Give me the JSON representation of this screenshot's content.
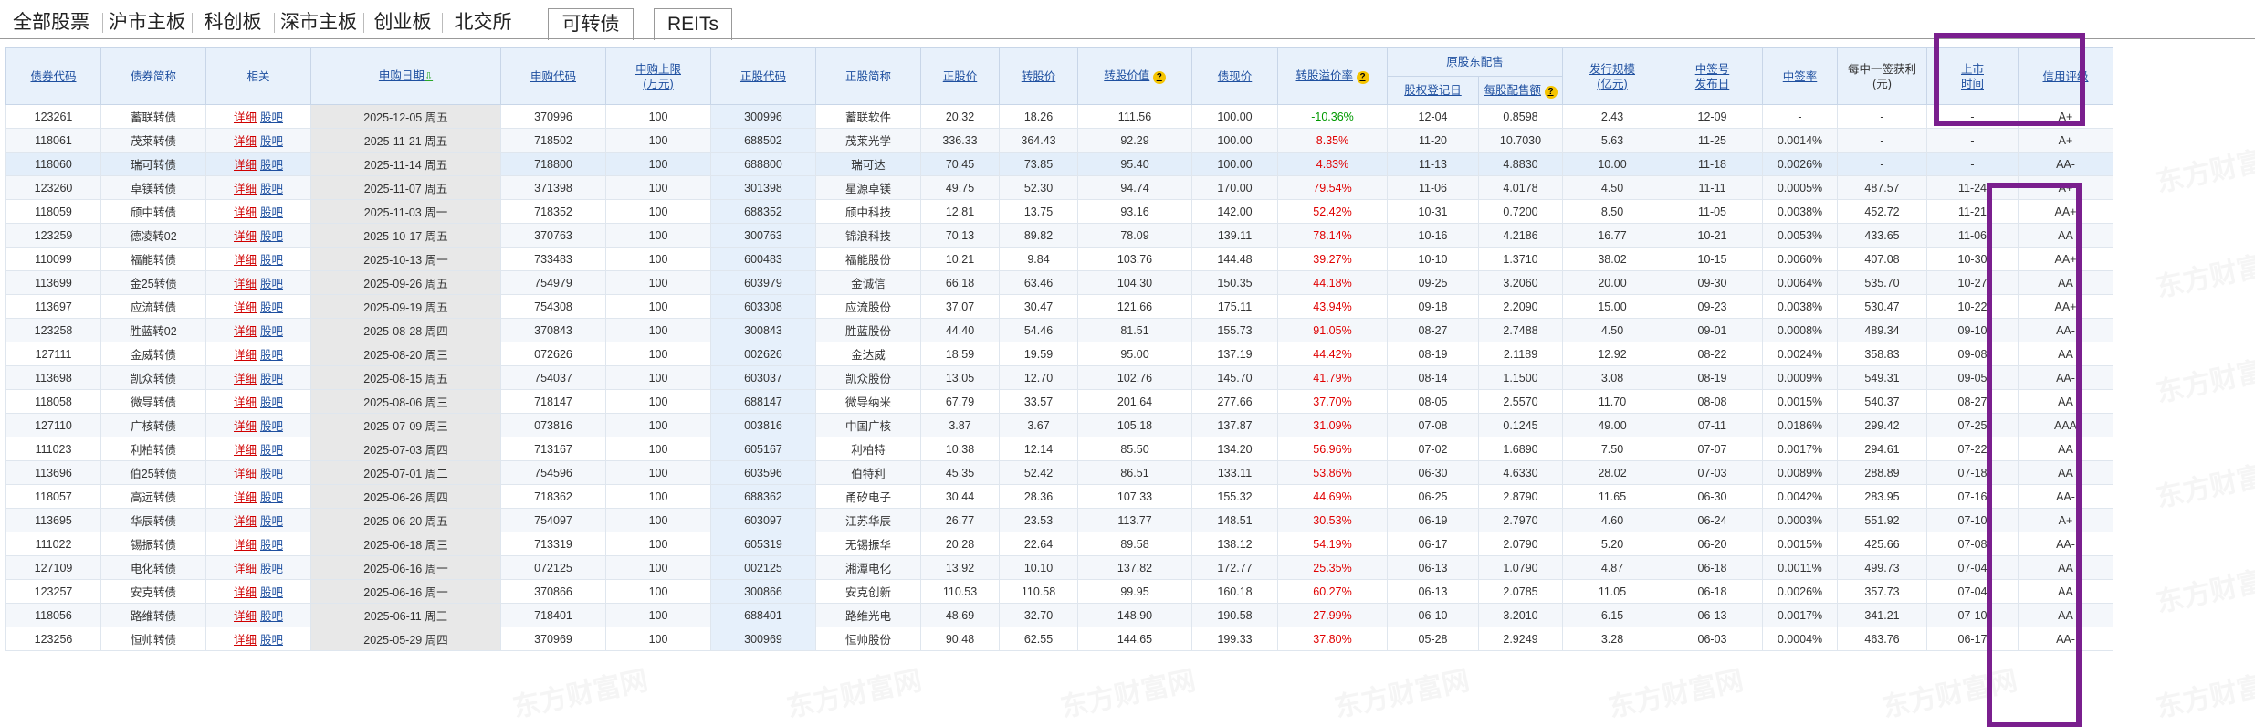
{
  "tabs": [
    {
      "label": "全部股票",
      "active": false
    },
    {
      "label": "沪市主板",
      "active": false
    },
    {
      "label": "科创板",
      "active": false
    },
    {
      "label": "深市主板",
      "active": false
    },
    {
      "label": "创业板",
      "active": false
    },
    {
      "label": "北交所",
      "active": false
    },
    {
      "label": "可转债",
      "active": true
    },
    {
      "label": "REITs",
      "active": false
    }
  ],
  "watermark": "东方财富网",
  "headers": {
    "bond_code": "债券代码",
    "bond_name": "债券简称",
    "related": "相关",
    "sub_date": "申购日期",
    "sub_code": "申购代码",
    "sub_limit_1": "申购上限",
    "sub_limit_2": "(万元)",
    "stock_code": "正股代码",
    "stock_name": "正股简称",
    "stock_price": "正股价",
    "conv_price": "转股价",
    "conv_value": "转股价值",
    "bond_price": "债现价",
    "premium": "转股溢价率",
    "placement": "原股东配售",
    "record_date": "股权登记日",
    "per_share": "每股配售额",
    "issue_size_1": "发行规模",
    "issue_size_2": "(亿元)",
    "lottery_1": "中签号",
    "lottery_2": "发布日",
    "win_rate": "中签率",
    "profit": "每中一签获利(元)",
    "listing_1": "上市",
    "listing_2": "时间",
    "rating": "信用评级"
  },
  "link_labels": {
    "detail": "详细",
    "forum": "股吧"
  },
  "rows": [
    {
      "code": "123261",
      "name": "蓄联转债",
      "date": "2025-12-05 周五",
      "sub_code": "370996",
      "limit": "100",
      "stock_code": "300996",
      "stock_name": "蓄联软件",
      "stock_price": "20.32",
      "conv_price": "18.26",
      "conv_value": "111.56",
      "bond_price": "100.00",
      "premium": "-10.36%",
      "record": "12-04",
      "per_share": "0.8598",
      "issue": "2.43",
      "lottery": "12-09",
      "rate": "-",
      "profit": "-",
      "listing": "-",
      "rating": "A+"
    },
    {
      "code": "118061",
      "name": "茂莱转债",
      "date": "2025-11-21 周五",
      "sub_code": "718502",
      "limit": "100",
      "stock_code": "688502",
      "stock_name": "茂莱光学",
      "stock_price": "336.33",
      "conv_price": "364.43",
      "conv_value": "92.29",
      "bond_price": "100.00",
      "premium": "8.35%",
      "record": "11-20",
      "per_share": "10.7030",
      "issue": "5.63",
      "lottery": "11-25",
      "rate": "0.0014%",
      "profit": "-",
      "listing": "-",
      "rating": "A+"
    },
    {
      "code": "118060",
      "name": "瑞可转债",
      "date": "2025-11-14 周五",
      "sub_code": "718800",
      "limit": "100",
      "stock_code": "688800",
      "stock_name": "瑞可达",
      "stock_price": "70.45",
      "conv_price": "73.85",
      "conv_value": "95.40",
      "bond_price": "100.00",
      "premium": "4.83%",
      "record": "11-13",
      "per_share": "4.8830",
      "issue": "10.00",
      "lottery": "11-18",
      "rate": "0.0026%",
      "profit": "-",
      "listing": "-",
      "rating": "AA-"
    },
    {
      "code": "123260",
      "name": "卓镁转债",
      "date": "2025-11-07 周五",
      "sub_code": "371398",
      "limit": "100",
      "stock_code": "301398",
      "stock_name": "星源卓镁",
      "stock_price": "49.75",
      "conv_price": "52.30",
      "conv_value": "94.74",
      "bond_price": "170.00",
      "premium": "79.54%",
      "record": "11-06",
      "per_share": "4.0178",
      "issue": "4.50",
      "lottery": "11-11",
      "rate": "0.0005%",
      "profit": "487.57",
      "listing": "11-24",
      "rating": "A+"
    },
    {
      "code": "118059",
      "name": "颀中转债",
      "date": "2025-11-03 周一",
      "sub_code": "718352",
      "limit": "100",
      "stock_code": "688352",
      "stock_name": "颀中科技",
      "stock_price": "12.81",
      "conv_price": "13.75",
      "conv_value": "93.16",
      "bond_price": "142.00",
      "premium": "52.42%",
      "record": "10-31",
      "per_share": "0.7200",
      "issue": "8.50",
      "lottery": "11-05",
      "rate": "0.0038%",
      "profit": "452.72",
      "listing": "11-21",
      "rating": "AA+"
    },
    {
      "code": "123259",
      "name": "德凌转02",
      "date": "2025-10-17 周五",
      "sub_code": "370763",
      "limit": "100",
      "stock_code": "300763",
      "stock_name": "锦浪科技",
      "stock_price": "70.13",
      "conv_price": "89.82",
      "conv_value": "78.09",
      "bond_price": "139.11",
      "premium": "78.14%",
      "record": "10-16",
      "per_share": "4.2186",
      "issue": "16.77",
      "lottery": "10-21",
      "rate": "0.0053%",
      "profit": "433.65",
      "listing": "11-06",
      "rating": "AA"
    },
    {
      "code": "110099",
      "name": "福能转债",
      "date": "2025-10-13 周一",
      "sub_code": "733483",
      "limit": "100",
      "stock_code": "600483",
      "stock_name": "福能股份",
      "stock_price": "10.21",
      "conv_price": "9.84",
      "conv_value": "103.76",
      "bond_price": "144.48",
      "premium": "39.27%",
      "record": "10-10",
      "per_share": "1.3710",
      "issue": "38.02",
      "lottery": "10-15",
      "rate": "0.0060%",
      "profit": "407.08",
      "listing": "10-30",
      "rating": "AA+"
    },
    {
      "code": "113699",
      "name": "金25转债",
      "date": "2025-09-26 周五",
      "sub_code": "754979",
      "limit": "100",
      "stock_code": "603979",
      "stock_name": "金诚信",
      "stock_price": "66.18",
      "conv_price": "63.46",
      "conv_value": "104.30",
      "bond_price": "150.35",
      "premium": "44.18%",
      "record": "09-25",
      "per_share": "3.2060",
      "issue": "20.00",
      "lottery": "09-30",
      "rate": "0.0064%",
      "profit": "535.70",
      "listing": "10-27",
      "rating": "AA"
    },
    {
      "code": "113697",
      "name": "应流转债",
      "date": "2025-09-19 周五",
      "sub_code": "754308",
      "limit": "100",
      "stock_code": "603308",
      "stock_name": "应流股份",
      "stock_price": "37.07",
      "conv_price": "30.47",
      "conv_value": "121.66",
      "bond_price": "175.11",
      "premium": "43.94%",
      "record": "09-18",
      "per_share": "2.2090",
      "issue": "15.00",
      "lottery": "09-23",
      "rate": "0.0038%",
      "profit": "530.47",
      "listing": "10-22",
      "rating": "AA+"
    },
    {
      "code": "123258",
      "name": "胜蓝转02",
      "date": "2025-08-28 周四",
      "sub_code": "370843",
      "limit": "100",
      "stock_code": "300843",
      "stock_name": "胜蓝股份",
      "stock_price": "44.40",
      "conv_price": "54.46",
      "conv_value": "81.51",
      "bond_price": "155.73",
      "premium": "91.05%",
      "record": "08-27",
      "per_share": "2.7488",
      "issue": "4.50",
      "lottery": "09-01",
      "rate": "0.0008%",
      "profit": "489.34",
      "listing": "09-10",
      "rating": "AA-"
    },
    {
      "code": "127111",
      "name": "金威转债",
      "date": "2025-08-20 周三",
      "sub_code": "072626",
      "limit": "100",
      "stock_code": "002626",
      "stock_name": "金达威",
      "stock_price": "18.59",
      "conv_price": "19.59",
      "conv_value": "95.00",
      "bond_price": "137.19",
      "premium": "44.42%",
      "record": "08-19",
      "per_share": "2.1189",
      "issue": "12.92",
      "lottery": "08-22",
      "rate": "0.0024%",
      "profit": "358.83",
      "listing": "09-08",
      "rating": "AA"
    },
    {
      "code": "113698",
      "name": "凯众转债",
      "date": "2025-08-15 周五",
      "sub_code": "754037",
      "limit": "100",
      "stock_code": "603037",
      "stock_name": "凯众股份",
      "stock_price": "13.05",
      "conv_price": "12.70",
      "conv_value": "102.76",
      "bond_price": "145.70",
      "premium": "41.79%",
      "record": "08-14",
      "per_share": "1.1500",
      "issue": "3.08",
      "lottery": "08-19",
      "rate": "0.0009%",
      "profit": "549.31",
      "listing": "09-05",
      "rating": "AA-"
    },
    {
      "code": "118058",
      "name": "微导转债",
      "date": "2025-08-06 周三",
      "sub_code": "718147",
      "limit": "100",
      "stock_code": "688147",
      "stock_name": "微导纳米",
      "stock_price": "67.79",
      "conv_price": "33.57",
      "conv_value": "201.64",
      "bond_price": "277.66",
      "premium": "37.70%",
      "record": "08-05",
      "per_share": "2.5570",
      "issue": "11.70",
      "lottery": "08-08",
      "rate": "0.0015%",
      "profit": "540.37",
      "listing": "08-27",
      "rating": "AA"
    },
    {
      "code": "127110",
      "name": "广核转债",
      "date": "2025-07-09 周三",
      "sub_code": "073816",
      "limit": "100",
      "stock_code": "003816",
      "stock_name": "中国广核",
      "stock_price": "3.87",
      "conv_price": "3.67",
      "conv_value": "105.18",
      "bond_price": "137.87",
      "premium": "31.09%",
      "record": "07-08",
      "per_share": "0.1245",
      "issue": "49.00",
      "lottery": "07-11",
      "rate": "0.0186%",
      "profit": "299.42",
      "listing": "07-25",
      "rating": "AAA"
    },
    {
      "code": "111023",
      "name": "利柏转债",
      "date": "2025-07-03 周四",
      "sub_code": "713167",
      "limit": "100",
      "stock_code": "605167",
      "stock_name": "利柏特",
      "stock_price": "10.38",
      "conv_price": "12.14",
      "conv_value": "85.50",
      "bond_price": "134.20",
      "premium": "56.96%",
      "record": "07-02",
      "per_share": "1.6890",
      "issue": "7.50",
      "lottery": "07-07",
      "rate": "0.0017%",
      "profit": "294.61",
      "listing": "07-22",
      "rating": "AA"
    },
    {
      "code": "113696",
      "name": "伯25转债",
      "date": "2025-07-01 周二",
      "sub_code": "754596",
      "limit": "100",
      "stock_code": "603596",
      "stock_name": "伯特利",
      "stock_price": "45.35",
      "conv_price": "52.42",
      "conv_value": "86.51",
      "bond_price": "133.11",
      "premium": "53.86%",
      "record": "06-30",
      "per_share": "4.6330",
      "issue": "28.02",
      "lottery": "07-03",
      "rate": "0.0089%",
      "profit": "288.89",
      "listing": "07-18",
      "rating": "AA"
    },
    {
      "code": "118057",
      "name": "高远转债",
      "date": "2025-06-26 周四",
      "sub_code": "718362",
      "limit": "100",
      "stock_code": "688362",
      "stock_name": "甬矽电子",
      "stock_price": "30.44",
      "conv_price": "28.36",
      "conv_value": "107.33",
      "bond_price": "155.32",
      "premium": "44.69%",
      "record": "06-25",
      "per_share": "2.8790",
      "issue": "11.65",
      "lottery": "06-30",
      "rate": "0.0042%",
      "profit": "283.95",
      "listing": "07-16",
      "rating": "AA-"
    },
    {
      "code": "113695",
      "name": "华辰转债",
      "date": "2025-06-20 周五",
      "sub_code": "754097",
      "limit": "100",
      "stock_code": "603097",
      "stock_name": "江苏华辰",
      "stock_price": "26.77",
      "conv_price": "23.53",
      "conv_value": "113.77",
      "bond_price": "148.51",
      "premium": "30.53%",
      "record": "06-19",
      "per_share": "2.7970",
      "issue": "4.60",
      "lottery": "06-24",
      "rate": "0.0003%",
      "profit": "551.92",
      "listing": "07-10",
      "rating": "A+"
    },
    {
      "code": "111022",
      "name": "锡振转债",
      "date": "2025-06-18 周三",
      "sub_code": "713319",
      "limit": "100",
      "stock_code": "605319",
      "stock_name": "无锡振华",
      "stock_price": "20.28",
      "conv_price": "22.64",
      "conv_value": "89.58",
      "bond_price": "138.12",
      "premium": "54.19%",
      "record": "06-17",
      "per_share": "2.0790",
      "issue": "5.20",
      "lottery": "06-20",
      "rate": "0.0015%",
      "profit": "425.66",
      "listing": "07-08",
      "rating": "AA-"
    },
    {
      "code": "127109",
      "name": "电化转债",
      "date": "2025-06-16 周一",
      "sub_code": "072125",
      "limit": "100",
      "stock_code": "002125",
      "stock_name": "湘潭电化",
      "stock_price": "13.92",
      "conv_price": "10.10",
      "conv_value": "137.82",
      "bond_price": "172.77",
      "premium": "25.35%",
      "record": "06-13",
      "per_share": "1.0790",
      "issue": "4.87",
      "lottery": "06-18",
      "rate": "0.0011%",
      "profit": "499.73",
      "listing": "07-04",
      "rating": "AA"
    },
    {
      "code": "123257",
      "name": "安克转债",
      "date": "2025-06-16 周一",
      "sub_code": "370866",
      "limit": "100",
      "stock_code": "300866",
      "stock_name": "安克创新",
      "stock_price": "110.53",
      "conv_price": "110.58",
      "conv_value": "99.95",
      "bond_price": "160.18",
      "premium": "60.27%",
      "record": "06-13",
      "per_share": "2.0785",
      "issue": "11.05",
      "lottery": "06-18",
      "rate": "0.0026%",
      "profit": "357.73",
      "listing": "07-04",
      "rating": "AA"
    },
    {
      "code": "118056",
      "name": "路维转债",
      "date": "2025-06-11 周三",
      "sub_code": "718401",
      "limit": "100",
      "stock_code": "688401",
      "stock_name": "路维光电",
      "stock_price": "48.69",
      "conv_price": "32.70",
      "conv_value": "148.90",
      "bond_price": "190.58",
      "premium": "27.99%",
      "record": "06-10",
      "per_share": "3.2010",
      "issue": "6.15",
      "lottery": "06-13",
      "rate": "0.0017%",
      "profit": "341.21",
      "listing": "07-10",
      "rating": "AA"
    },
    {
      "code": "123256",
      "name": "恒帅转债",
      "date": "2025-05-29 周四",
      "sub_code": "370969",
      "limit": "100",
      "stock_code": "300969",
      "stock_name": "恒帅股份",
      "stock_price": "90.48",
      "conv_price": "62.55",
      "conv_value": "144.65",
      "bond_price": "199.33",
      "premium": "37.80%",
      "record": "05-28",
      "per_share": "2.9249",
      "issue": "3.28",
      "lottery": "06-03",
      "rate": "0.0004%",
      "profit": "463.76",
      "listing": "06-17",
      "rating": "AA-"
    }
  ],
  "colors": {
    "header_bg": "#e8f1fb",
    "link": "#1f50a0",
    "red": "#e00000",
    "annotation": "#7a1f8e"
  }
}
